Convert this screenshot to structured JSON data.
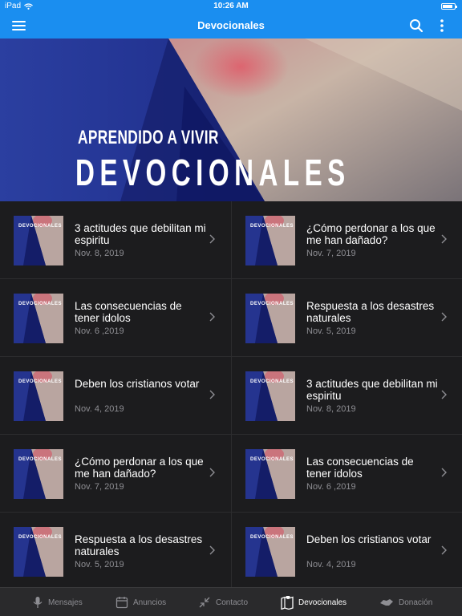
{
  "status": {
    "device": "iPad",
    "time": "10:26 AM",
    "battery_level": 0.85
  },
  "appbar": {
    "title": "Devocionales"
  },
  "hero": {
    "kicker": "APRENDIDO A VIVIR",
    "title": "DEVOCIONALES"
  },
  "thumb_label": "DEVOCIONALES",
  "items": [
    {
      "title": "3 actitudes que debilitan mi espiritu",
      "date": "Nov. 8, 2019"
    },
    {
      "title": "¿Cómo perdonar a los que me han dañado?",
      "date": "Nov. 7, 2019"
    },
    {
      "title": "Las consecuencias de tener idolos",
      "date": "Nov. 6 ,2019"
    },
    {
      "title": "Respuesta a los desastres naturales",
      "date": "Nov. 5, 2019"
    },
    {
      "title": "Deben los cristianos votar",
      "date": "Nov. 4, 2019"
    },
    {
      "title": "3 actitudes que debilitan mi espiritu",
      "date": "Nov. 8, 2019"
    },
    {
      "title": "¿Cómo perdonar a los que me han dañado?",
      "date": "Nov. 7, 2019"
    },
    {
      "title": "Las consecuencias de tener idolos",
      "date": "Nov. 6 ,2019"
    },
    {
      "title": "Respuesta a los desastres naturales",
      "date": "Nov. 5, 2019"
    },
    {
      "title": "Deben los cristianos votar",
      "date": "Nov. 4, 2019"
    }
  ],
  "tabs": [
    {
      "label": "Mensajes",
      "icon": "microphone-icon",
      "active": false
    },
    {
      "label": "Anuncios",
      "icon": "calendar-icon",
      "active": false
    },
    {
      "label": "Contacto",
      "icon": "compress-arrows-icon",
      "active": false
    },
    {
      "label": "Devocionales",
      "icon": "map-pin-icon",
      "active": true
    },
    {
      "label": "Donación",
      "icon": "handshake-icon",
      "active": false
    }
  ],
  "colors": {
    "brand": "#1a8ef0",
    "background": "#1c1c1e",
    "tabbar": "#2a2a2c",
    "muted": "#8e8e93"
  }
}
